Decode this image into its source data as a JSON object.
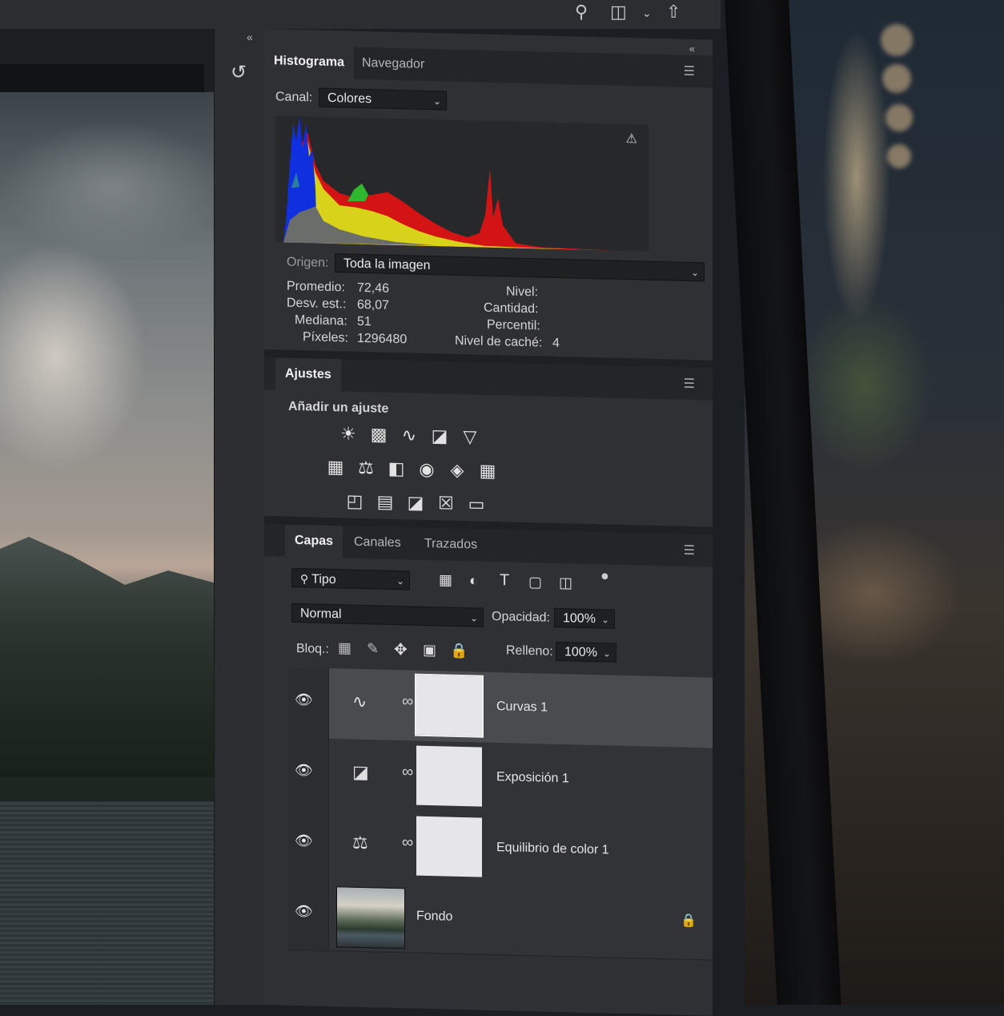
{
  "panel": {
    "histogram": {
      "tabs": [
        "Histograma",
        "Navegador"
      ],
      "canal_label": "Canal:",
      "canal_value": "Colores",
      "warning_icon": "warning-icon",
      "origen_label": "Origen:",
      "origen_value": "Toda la imagen",
      "stats_left": [
        {
          "label": "Promedio:",
          "value": "72,46"
        },
        {
          "label": "Desv. est.:",
          "value": "68,07"
        },
        {
          "label": "Mediana:",
          "value": "51"
        },
        {
          "label": "Píxeles:",
          "value": "1296480"
        }
      ],
      "stats_right": [
        {
          "label": "Nivel:",
          "value": ""
        },
        {
          "label": "Cantidad:",
          "value": ""
        },
        {
          "label": "Percentil:",
          "value": ""
        },
        {
          "label": "Nivel de caché:",
          "value": "4"
        }
      ]
    },
    "adjustments": {
      "tab": "Ajustes",
      "add_label": "Añadir un ajuste",
      "icons_row1": [
        "brightness-contrast-icon",
        "levels-icon",
        "curves-icon",
        "exposure-icon",
        "vibrance-icon"
      ],
      "icons_row2": [
        "hue-saturation-icon",
        "color-balance-icon",
        "black-white-icon",
        "photo-filter-icon",
        "channel-mixer-icon",
        "color-lookup-icon"
      ],
      "icons_row3": [
        "invert-icon",
        "posterize-icon",
        "threshold-icon",
        "selective-color-icon",
        "gradient-map-icon"
      ]
    },
    "layers": {
      "tabs": [
        "Capas",
        "Canales",
        "Trazados"
      ],
      "filter_value": "Tipo",
      "blend_mode": "Normal",
      "opacity_label": "Opacidad:",
      "opacity_value": "100%",
      "lock_label": "Bloq.:",
      "fill_label": "Relleno:",
      "fill_value": "100%",
      "items": [
        {
          "name": "Curvas 1",
          "type_icon": "curves-icon",
          "selected": true
        },
        {
          "name": "Exposición 1",
          "type_icon": "exposure-icon",
          "selected": false
        },
        {
          "name": "Equilibrio de color 1",
          "type_icon": "color-balance-icon",
          "selected": false
        },
        {
          "name": "Fondo",
          "type_icon": "image-thumbnail",
          "locked": true,
          "selected": false
        }
      ]
    }
  },
  "colors": {
    "panel_bg": "#2f3033",
    "tab_bg": "#242527",
    "selected_layer": "#4a4b4e",
    "histogram_red": "#d41414",
    "histogram_green": "#2fb82f",
    "histogram_blue": "#1030e0",
    "histogram_yellow": "#d8d21a"
  }
}
